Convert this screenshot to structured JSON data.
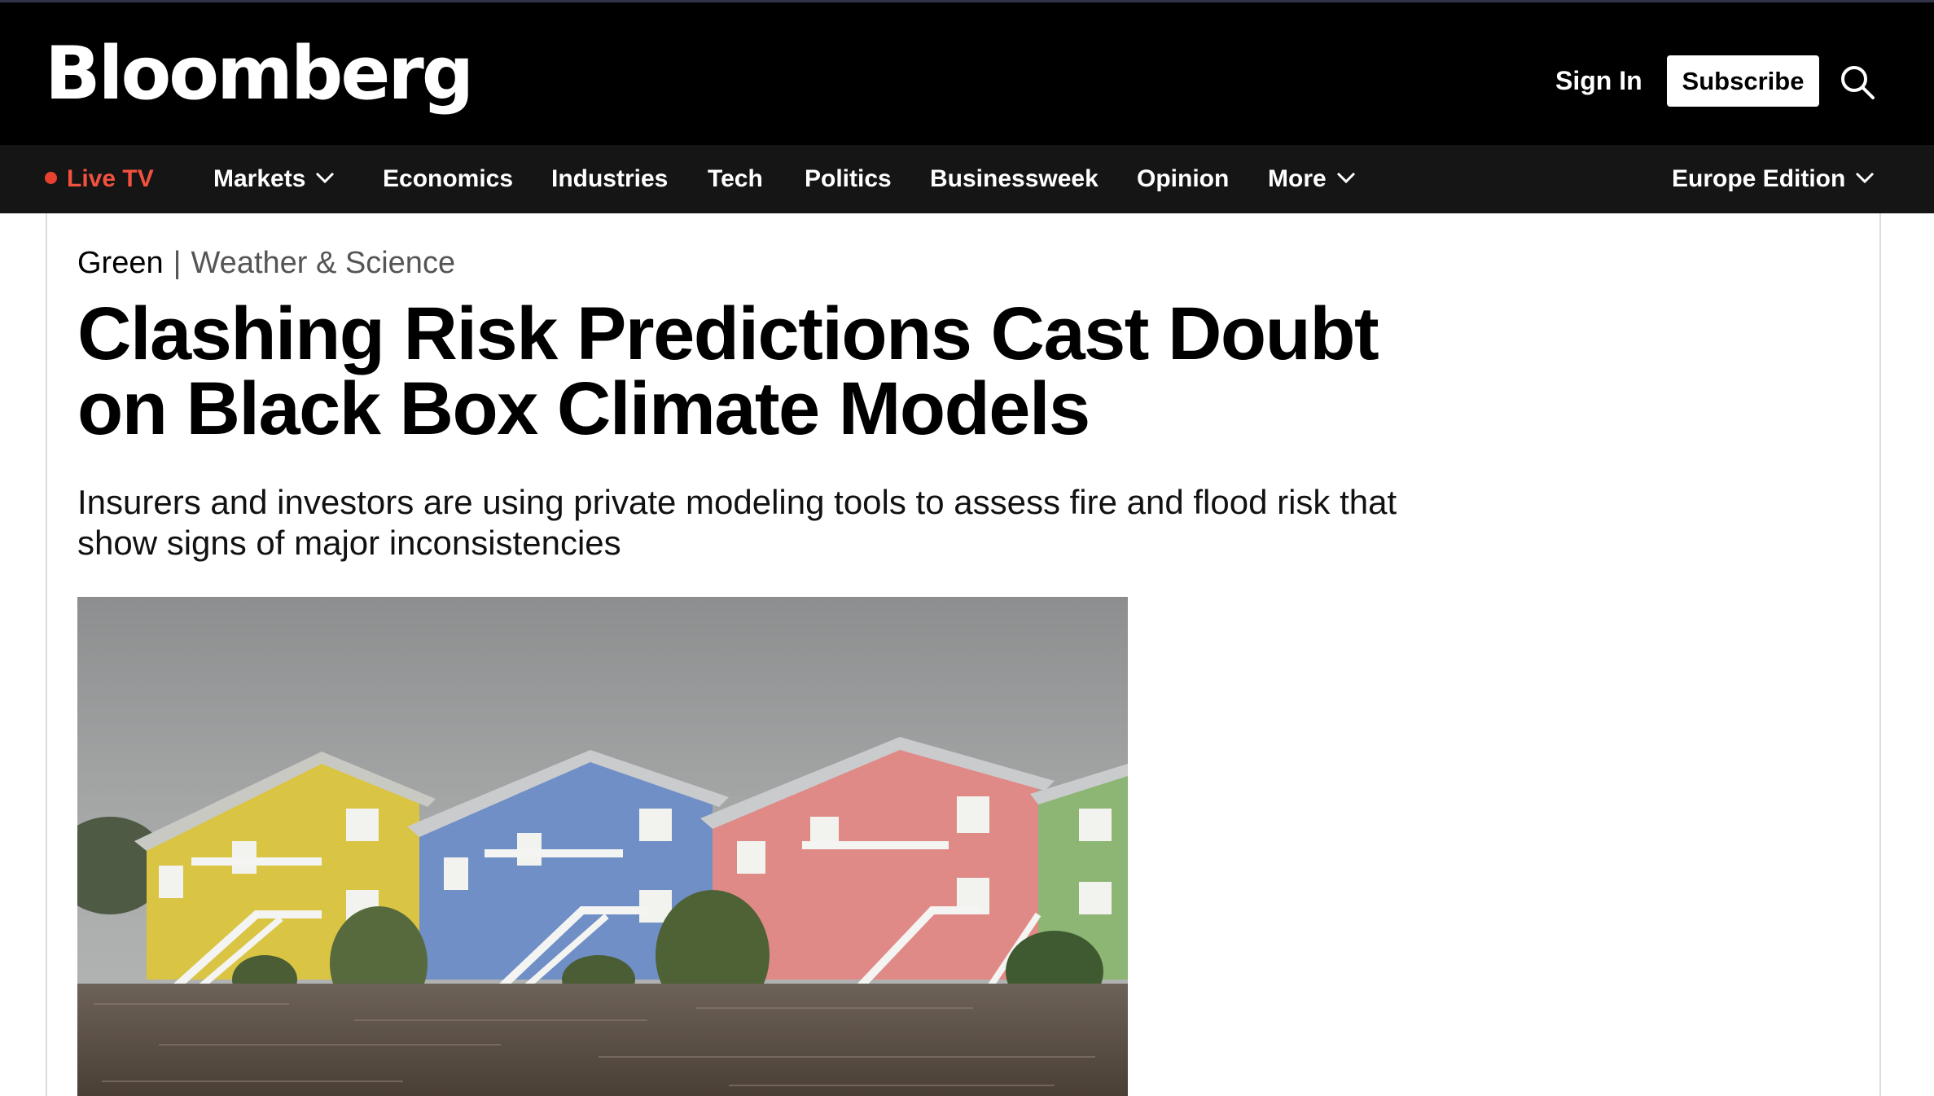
{
  "header": {
    "logo": "Bloomberg",
    "sign_in": "Sign In",
    "subscribe": "Subscribe",
    "search_icon": "search-icon"
  },
  "nav": {
    "live_tv": "Live TV",
    "items": [
      "Markets",
      "Economics",
      "Industries",
      "Tech",
      "Politics",
      "Businessweek",
      "Opinion",
      "More"
    ],
    "edition": "Europe Edition",
    "colors": {
      "live": "#f2513f",
      "bar": "#151515"
    }
  },
  "article": {
    "section": "Green",
    "subsection": "Weather & Science",
    "headline": "Clashing Risk Predictions Cast Doubt on Black Box Climate Models",
    "dek": "Insurers and investors are using private modeling tools to assess fire and flood risk that show signs of major inconsistencies",
    "image": "flooded-colorful-condominiums-photo"
  }
}
